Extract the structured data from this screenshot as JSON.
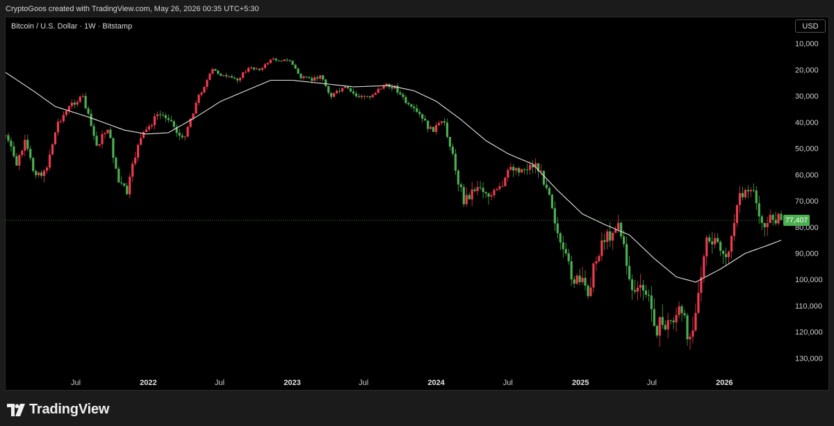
{
  "caption": "CryptoGoos created with TradingView.com, May 26, 2026 00:35 UTC+5:30",
  "symbol_title": "Bitcoin / U.S. Dollar · 1W · Bitstamp",
  "currency_button": "USD",
  "last_price_label": "77,407",
  "brand": "TradingView",
  "colors": {
    "up": "#4caf50",
    "down": "#ef3b4e",
    "ma": "#e8e8e8",
    "background": "#000000"
  },
  "chart_data": {
    "type": "candlestick",
    "scale": "inverted",
    "ylim": [
      0,
      136000
    ],
    "y_ticks": [
      {
        "value": 10000,
        "label": "10,000"
      },
      {
        "value": 20000,
        "label": "20,000"
      },
      {
        "value": 30000,
        "label": "30,000"
      },
      {
        "value": 40000,
        "label": "40,000"
      },
      {
        "value": 50000,
        "label": "50,000"
      },
      {
        "value": 60000,
        "label": "60,000"
      },
      {
        "value": 70000,
        "label": "70,000"
      },
      {
        "value": 80000,
        "label": "80,000"
      },
      {
        "value": 90000,
        "label": "90,000"
      },
      {
        "value": 100000,
        "label": "100,000"
      },
      {
        "value": 110000,
        "label": "110,000"
      },
      {
        "value": 120000,
        "label": "120,000"
      },
      {
        "value": 130000,
        "label": "130,000"
      }
    ],
    "xlim": [
      "2021-01-04",
      "2026-06-01"
    ],
    "x_ticks": [
      {
        "date": "2021-07-01",
        "label": "Jul",
        "bold": false
      },
      {
        "date": "2022-01-01",
        "label": "2022",
        "bold": true
      },
      {
        "date": "2022-07-01",
        "label": "Jul",
        "bold": false
      },
      {
        "date": "2023-01-01",
        "label": "2023",
        "bold": true
      },
      {
        "date": "2023-07-01",
        "label": "Jul",
        "bold": false
      },
      {
        "date": "2024-01-01",
        "label": "2024",
        "bold": true
      },
      {
        "date": "2024-07-01",
        "label": "Jul",
        "bold": false
      },
      {
        "date": "2025-01-01",
        "label": "2025",
        "bold": true
      },
      {
        "date": "2025-07-01",
        "label": "Jul",
        "bold": false
      },
      {
        "date": "2026-01-01",
        "label": "2026",
        "bold": true
      }
    ],
    "last_price": 77407,
    "price_path": [
      [
        "2021-01-04",
        45000
      ],
      [
        "2021-02-01",
        56000
      ],
      [
        "2021-02-22",
        48000
      ],
      [
        "2021-03-15",
        58000
      ],
      [
        "2021-04-12",
        60000
      ],
      [
        "2021-05-17",
        40000
      ],
      [
        "2021-06-21",
        33000
      ],
      [
        "2021-07-19",
        30500
      ],
      [
        "2021-08-23",
        49000
      ],
      [
        "2021-09-20",
        42000
      ],
      [
        "2021-10-18",
        63000
      ],
      [
        "2021-11-08",
        67000
      ],
      [
        "2021-12-06",
        48000
      ],
      [
        "2022-01-24",
        37000
      ],
      [
        "2022-02-21",
        38000
      ],
      [
        "2022-03-28",
        47000
      ],
      [
        "2022-05-09",
        30000
      ],
      [
        "2022-06-13",
        20000
      ],
      [
        "2022-07-18",
        23000
      ],
      [
        "2022-08-15",
        23500
      ],
      [
        "2022-09-12",
        19500
      ],
      [
        "2022-10-17",
        19500
      ],
      [
        "2022-11-07",
        16000
      ],
      [
        "2022-12-26",
        16500
      ],
      [
        "2023-01-23",
        23000
      ],
      [
        "2023-02-20",
        24000
      ],
      [
        "2023-03-13",
        22000
      ],
      [
        "2023-04-10",
        30000
      ],
      [
        "2023-05-15",
        27000
      ],
      [
        "2023-06-19",
        30500
      ],
      [
        "2023-07-17",
        30000
      ],
      [
        "2023-08-21",
        26000
      ],
      [
        "2023-09-18",
        26500
      ],
      [
        "2023-10-23",
        34000
      ],
      [
        "2023-11-20",
        37500
      ],
      [
        "2023-12-18",
        43000
      ],
      [
        "2024-01-22",
        40000
      ],
      [
        "2024-02-26",
        62000
      ],
      [
        "2024-03-11",
        70000
      ],
      [
        "2024-04-15",
        64000
      ],
      [
        "2024-05-20",
        68000
      ],
      [
        "2024-06-17",
        65000
      ],
      [
        "2024-07-08",
        57000
      ],
      [
        "2024-08-05",
        58000
      ],
      [
        "2024-09-09",
        56000
      ],
      [
        "2024-10-14",
        66000
      ],
      [
        "2024-11-11",
        88000
      ],
      [
        "2024-12-16",
        100000
      ],
      [
        "2025-01-20",
        104000
      ],
      [
        "2025-02-24",
        85000
      ],
      [
        "2025-03-17",
        83000
      ],
      [
        "2025-04-07",
        78000
      ],
      [
        "2025-05-12",
        104000
      ],
      [
        "2025-06-16",
        105000
      ],
      [
        "2025-07-14",
        118000
      ],
      [
        "2025-08-11",
        117000
      ],
      [
        "2025-09-08",
        112000
      ],
      [
        "2025-10-06",
        122000
      ],
      [
        "2025-10-20",
        110000
      ],
      [
        "2025-11-17",
        86000
      ],
      [
        "2025-12-15",
        87000
      ],
      [
        "2026-01-12",
        92000
      ],
      [
        "2026-02-02",
        70000
      ],
      [
        "2026-02-23",
        66000
      ],
      [
        "2026-03-16",
        68000
      ],
      [
        "2026-04-13",
        80000
      ],
      [
        "2026-05-04",
        76000
      ],
      [
        "2026-05-25",
        77407
      ]
    ],
    "moving_average": [
      [
        "2021-01-04",
        21000
      ],
      [
        "2021-03-15",
        28000
      ],
      [
        "2021-05-10",
        34000
      ],
      [
        "2021-08-02",
        38000
      ],
      [
        "2021-11-01",
        43000
      ],
      [
        "2021-12-27",
        44500
      ],
      [
        "2022-02-21",
        44000
      ],
      [
        "2022-05-02",
        38000
      ],
      [
        "2022-07-04",
        32000
      ],
      [
        "2022-09-05",
        28000
      ],
      [
        "2022-11-07",
        24000
      ],
      [
        "2023-01-02",
        24000
      ],
      [
        "2023-03-06",
        25000
      ],
      [
        "2023-06-05",
        26500
      ],
      [
        "2023-09-04",
        26000
      ],
      [
        "2023-11-06",
        28000
      ],
      [
        "2024-01-01",
        32000
      ],
      [
        "2024-03-04",
        39000
      ],
      [
        "2024-05-06",
        47000
      ],
      [
        "2024-07-01",
        52000
      ],
      [
        "2024-09-02",
        56000
      ],
      [
        "2024-11-04",
        66000
      ],
      [
        "2025-01-06",
        75000
      ],
      [
        "2025-03-03",
        79000
      ],
      [
        "2025-05-05",
        83000
      ],
      [
        "2025-07-07",
        92000
      ],
      [
        "2025-09-01",
        99000
      ],
      [
        "2025-10-20",
        101000
      ],
      [
        "2025-12-22",
        96000
      ],
      [
        "2026-02-23",
        90000
      ],
      [
        "2026-04-20",
        87000
      ],
      [
        "2026-05-25",
        85000
      ]
    ]
  }
}
